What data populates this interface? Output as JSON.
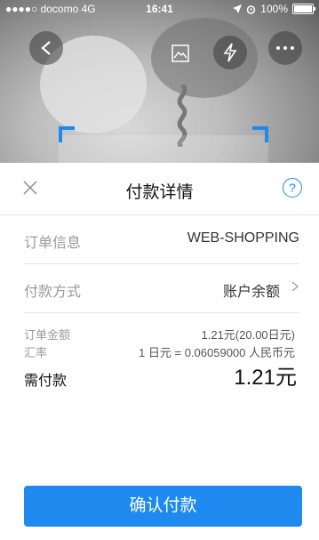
{
  "status_bar": {
    "carrier": "●●●●○ docomo",
    "network": "4G",
    "time": "16:41",
    "battery": "100%"
  },
  "camera": {
    "icons": [
      "back-icon",
      "gallery-icon",
      "flash-icon",
      "more-icon"
    ]
  },
  "sheet": {
    "title": "付款详情",
    "help_symbol": "?",
    "order_info": {
      "label": "订单信息",
      "value": "WEB-SHOPPING"
    },
    "payment_method": {
      "label": "付款方式",
      "value": "账户余额"
    },
    "order_amount": {
      "label": "订单金额",
      "value": "1.21元(20.00日元)"
    },
    "exchange_rate": {
      "label": "汇率",
      "value": "1 日元 = 0.06059000 人民币元"
    },
    "amount_due": {
      "label": "需付款",
      "value": "1.21元"
    },
    "confirm_button": "确认付款"
  },
  "colors": {
    "accent": "#1e8af0",
    "label_gray": "#9a9a9a",
    "divider": "#e6e6e6"
  }
}
